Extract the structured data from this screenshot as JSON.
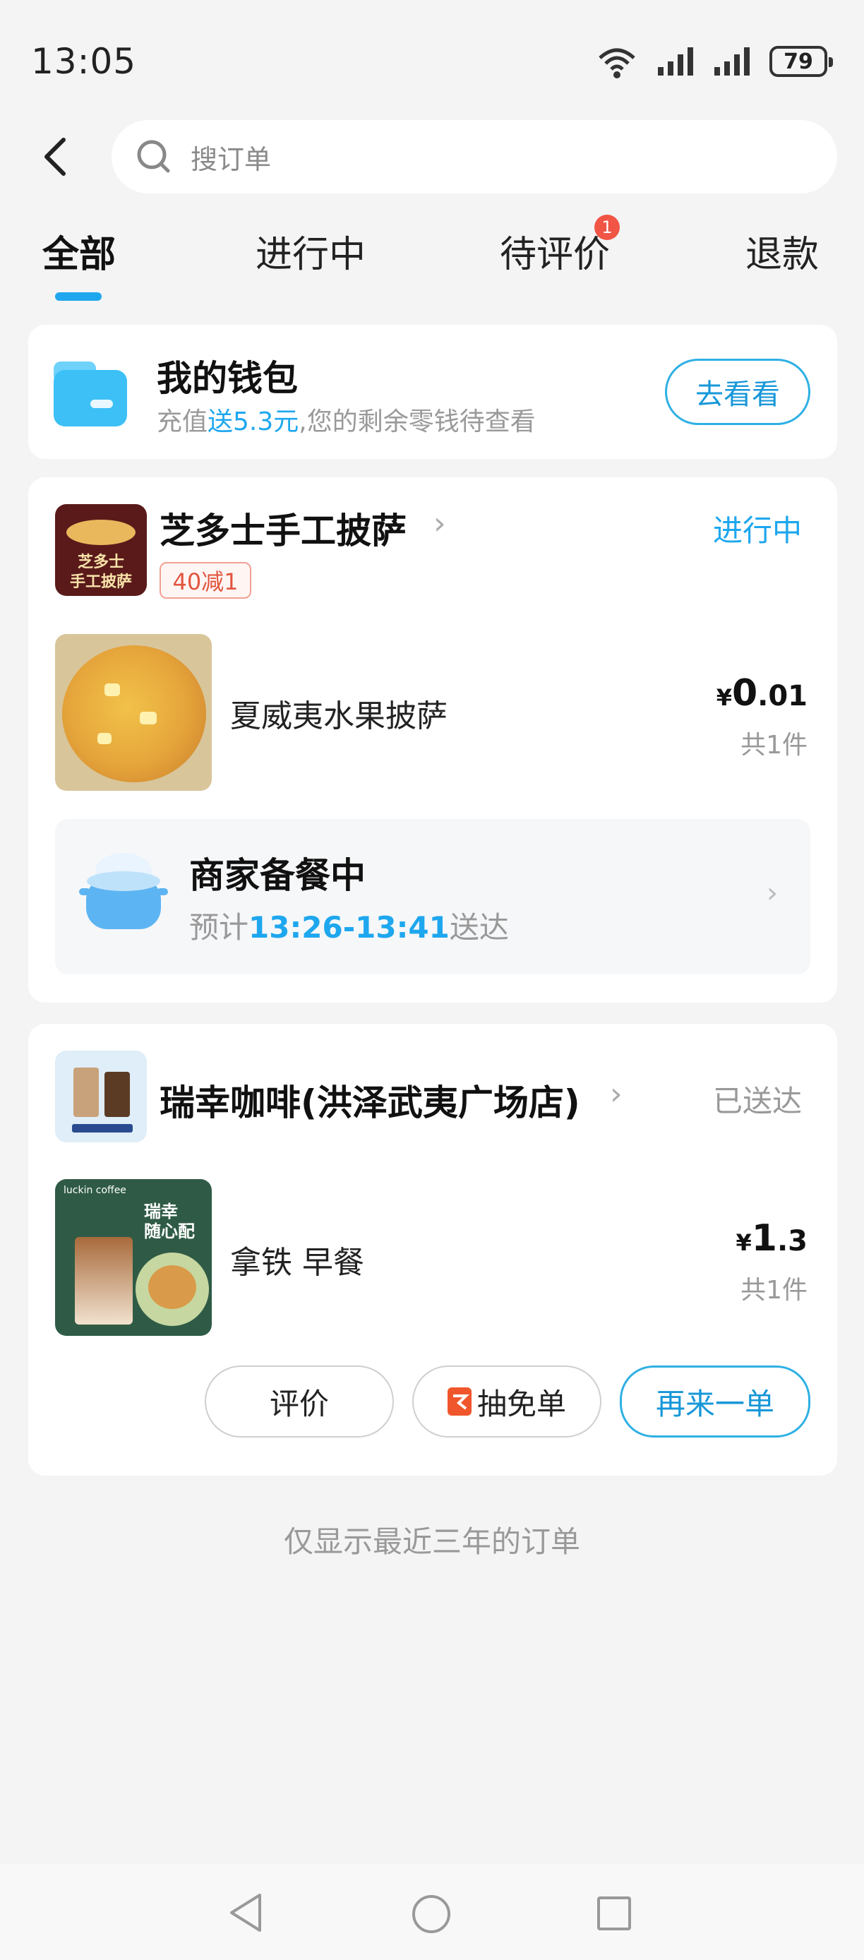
{
  "status_bar": {
    "time": "13:05",
    "battery": "79"
  },
  "search": {
    "placeholder": "搜订单"
  },
  "tabs": [
    {
      "label": "全部",
      "active": true
    },
    {
      "label": "进行中"
    },
    {
      "label": "待评价",
      "badge": "1"
    },
    {
      "label": "退款"
    }
  ],
  "wallet": {
    "title": "我的钱包",
    "sub_prefix": "充值",
    "sub_highlight": "送5.3元",
    "sub_suffix": ",您的剩余零钱待查看",
    "button": "去看看"
  },
  "orders": [
    {
      "shop": "芝多士手工披萨",
      "logo_text_1": "芝多士",
      "logo_text_2": "手工披萨",
      "status": "进行中",
      "promo": "40减1",
      "item": "夏威夷水果披萨",
      "price_currency": "¥",
      "price_int": "0",
      "price_dec": ".01",
      "count": "共1件",
      "prep_title": "商家备餐中",
      "eta_prefix": "预计",
      "eta_time": "13:26-13:41",
      "eta_suffix": "送达"
    },
    {
      "shop": "瑞幸咖啡(洪泽武夷广场店)",
      "status": "已送达",
      "item": "拿铁 早餐",
      "item_img_text_brand": "luckin coffee",
      "item_img_text_1": "瑞幸",
      "item_img_text_2": "随心配",
      "price_currency": "¥",
      "price_int": "1",
      "price_dec": ".3",
      "count": "共1件",
      "buttons": {
        "review": "评价",
        "lottery": "抽免单",
        "reorder": "再来一单"
      }
    }
  ],
  "footer_note": "仅显示最近三年的订单",
  "colors": {
    "accent": "#1ea7ee",
    "badge": "#f05545",
    "promo": "#e2553f"
  }
}
